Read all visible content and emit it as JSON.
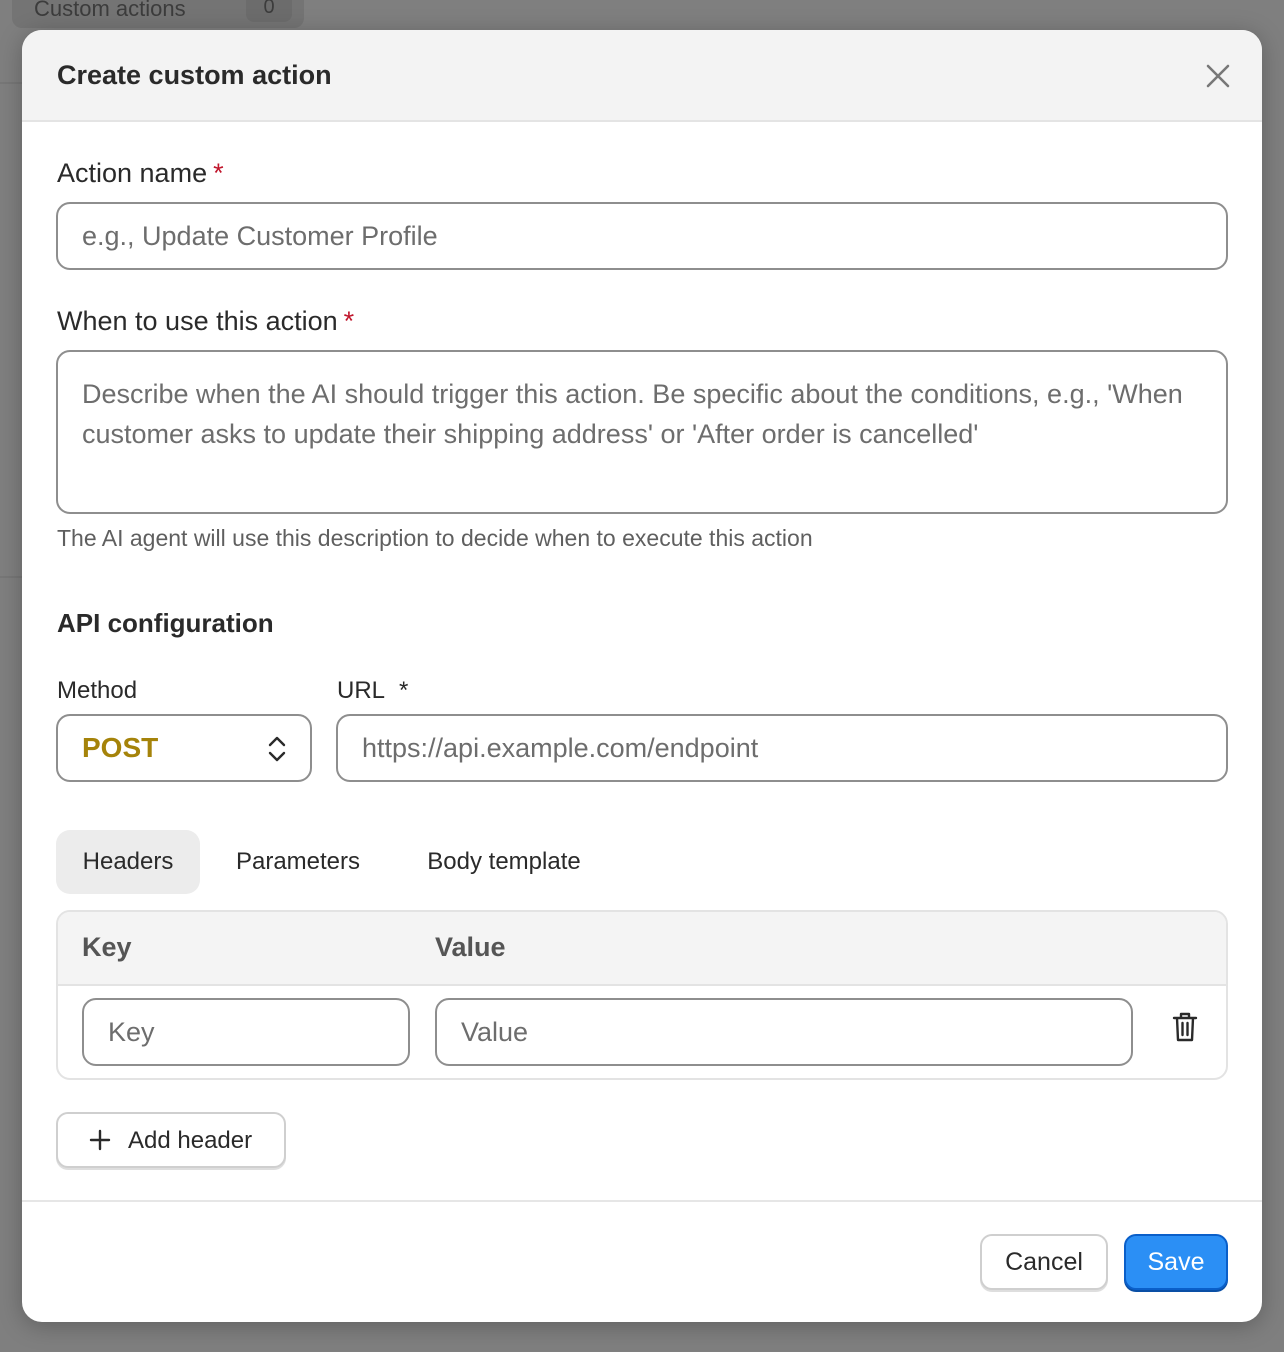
{
  "background": {
    "tab_label": "Custom actions",
    "tab_count": "0"
  },
  "modal": {
    "title": "Create custom action",
    "close_icon": "close-icon"
  },
  "action_name": {
    "label": "Action name",
    "required_mark": "*",
    "placeholder": "e.g., Update Customer Profile",
    "value": ""
  },
  "when_to_use": {
    "label": "When to use this action",
    "required_mark": "*",
    "placeholder": "Describe when the AI should trigger this action. Be specific about the conditions, e.g., 'When customer asks to update their shipping address' or 'After order is cancelled'",
    "value": "",
    "hint": "The AI agent will use this description to decide when to execute this action"
  },
  "api_config": {
    "title": "API configuration",
    "method_label": "Method",
    "method_value": "POST",
    "url_label": "URL",
    "url_required_mark": "*",
    "url_placeholder": "https://api.example.com/endpoint",
    "url_value": ""
  },
  "tabs": [
    {
      "label": "Headers",
      "active": true
    },
    {
      "label": "Parameters",
      "active": false
    },
    {
      "label": "Body template",
      "active": false
    }
  ],
  "headers_table": {
    "columns": [
      "Key",
      "Value"
    ],
    "rows": [
      {
        "key_placeholder": "Key",
        "value_placeholder": "Value",
        "key": "",
        "value": ""
      }
    ],
    "delete_icon": "trash-icon"
  },
  "add_header_label": "Add header",
  "footer": {
    "cancel_label": "Cancel",
    "save_label": "Save"
  },
  "colors": {
    "accent": "#2b8ff5",
    "required": "#c0162c",
    "method": "#a5830a"
  }
}
